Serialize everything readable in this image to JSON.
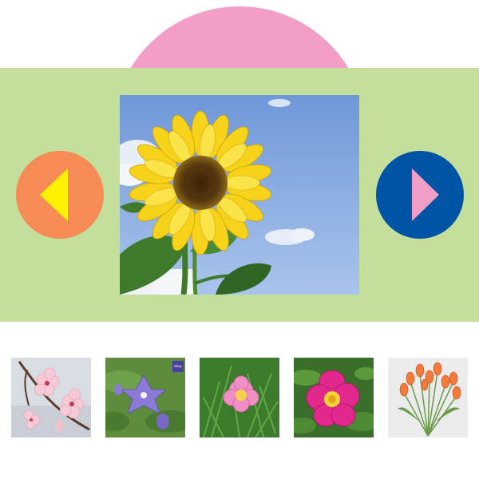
{
  "colors": {
    "dome": "#f29ec7",
    "band": "#c4df9b",
    "prev_button": "#f68b55",
    "prev_arrow": "#fff200",
    "next_button": "#0054a6",
    "next_arrow": "#f29ec7"
  },
  "carousel": {
    "current_image": "sunflower",
    "prev_icon": "triangle-left-icon",
    "next_icon": "triangle-right-icon"
  },
  "thumbnails": [
    {
      "image": "peach-blossom"
    },
    {
      "image": "balloon-flower",
      "badge": "ebay"
    },
    {
      "image": "pink-peony"
    },
    {
      "image": "magenta-peony"
    },
    {
      "image": "orange-tulips"
    }
  ]
}
